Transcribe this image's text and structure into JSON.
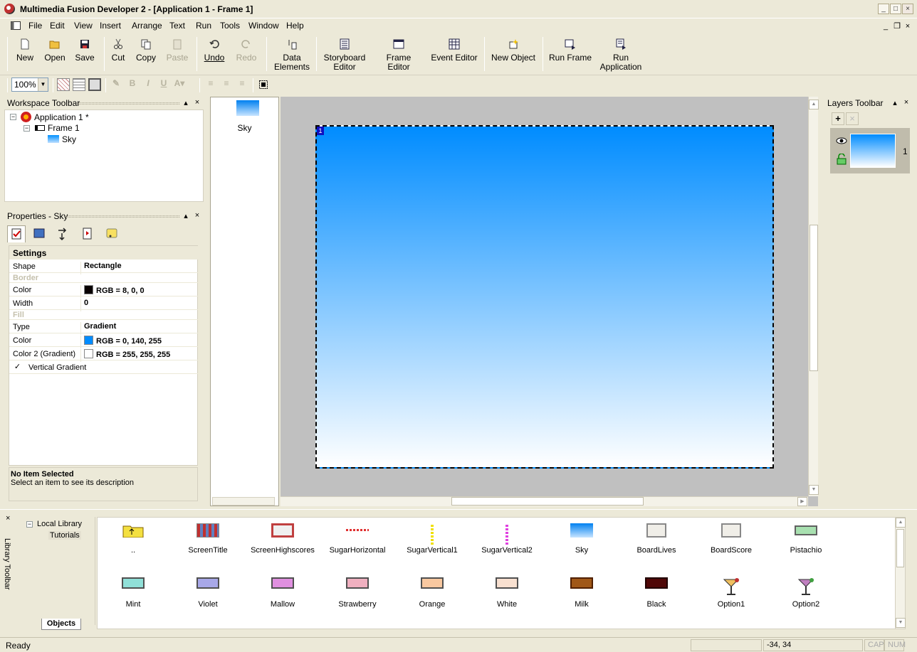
{
  "titlebar": {
    "title": "Multimedia Fusion Developer 2 - [Application 1 - Frame 1]"
  },
  "menu": [
    "File",
    "Edit",
    "View",
    "Insert",
    "Arrange",
    "Text",
    "Run",
    "Tools",
    "Window",
    "Help"
  ],
  "toolbar": {
    "new": "New",
    "open": "Open",
    "save": "Save",
    "cut": "Cut",
    "copy": "Copy",
    "paste": "Paste",
    "undo": "Undo",
    "redo": "Redo",
    "data_elements_1": "Data",
    "data_elements_2": "Elements",
    "storyboard_1": "Storyboard",
    "storyboard_2": "Editor",
    "frame_editor": "Frame Editor",
    "event_editor": "Event Editor",
    "new_object": "New Object",
    "run_frame": "Run Frame",
    "run_app_1": "Run",
    "run_app_2": "Application"
  },
  "toolbar2": {
    "zoom": "100%",
    "bold": "B",
    "italic": "I",
    "underline": "U"
  },
  "workspace": {
    "title": "Workspace Toolbar",
    "tree": {
      "app": "Application 1 *",
      "frame": "Frame 1",
      "object": "Sky"
    }
  },
  "properties": {
    "title": "Properties - Sky",
    "section": "Settings",
    "rows": {
      "shape_k": "Shape",
      "shape_v": "Rectangle",
      "border": "Border",
      "bcolor_k": "Color",
      "bcolor_v": "RGB = 8, 0, 0",
      "width_k": "Width",
      "width_v": "0",
      "fill": "Fill",
      "type_k": "Type",
      "type_v": "Gradient",
      "fcolor_k": "Color",
      "fcolor_v": "RGB = 0, 140, 255",
      "fcolor2_k": "Color 2 (Gradient)",
      "fcolor2_v": "RGB = 255, 255, 255",
      "vgrad": "Vertical Gradient"
    },
    "colors": {
      "border": "#080000",
      "fill1": "#008cff",
      "fill2": "#ffffff"
    },
    "vgrad_checked": "✓",
    "desc_title": "No Item Selected",
    "desc_text": "Select an item to see its description"
  },
  "objlist": {
    "item": "Sky"
  },
  "frame": {
    "layer_badge": "1"
  },
  "layers": {
    "title": "Layers Toolbar",
    "layer_num": "1",
    "add": "+",
    "delete": "×"
  },
  "library": {
    "title": "Library Toolbar",
    "tree": {
      "root": "Local Library",
      "child": "Tutorials"
    },
    "tab": "Objects",
    "row1": [
      "..",
      "ScreenTitle",
      "ScreenHighscores",
      "SugarHorizontal",
      "SugarVertical1",
      "SugarVertical2",
      "Sky",
      "BoardLives",
      "BoardScore",
      "Pistachio"
    ],
    "row2": [
      "Mint",
      "Violet",
      "Mallow",
      "Strawberry",
      "Orange",
      "White",
      "Milk",
      "Black",
      "Option1",
      "Option2"
    ]
  },
  "status": {
    "text": "Ready",
    "coords": "-34, 34",
    "cap": "CAP",
    "num": "NUM"
  }
}
